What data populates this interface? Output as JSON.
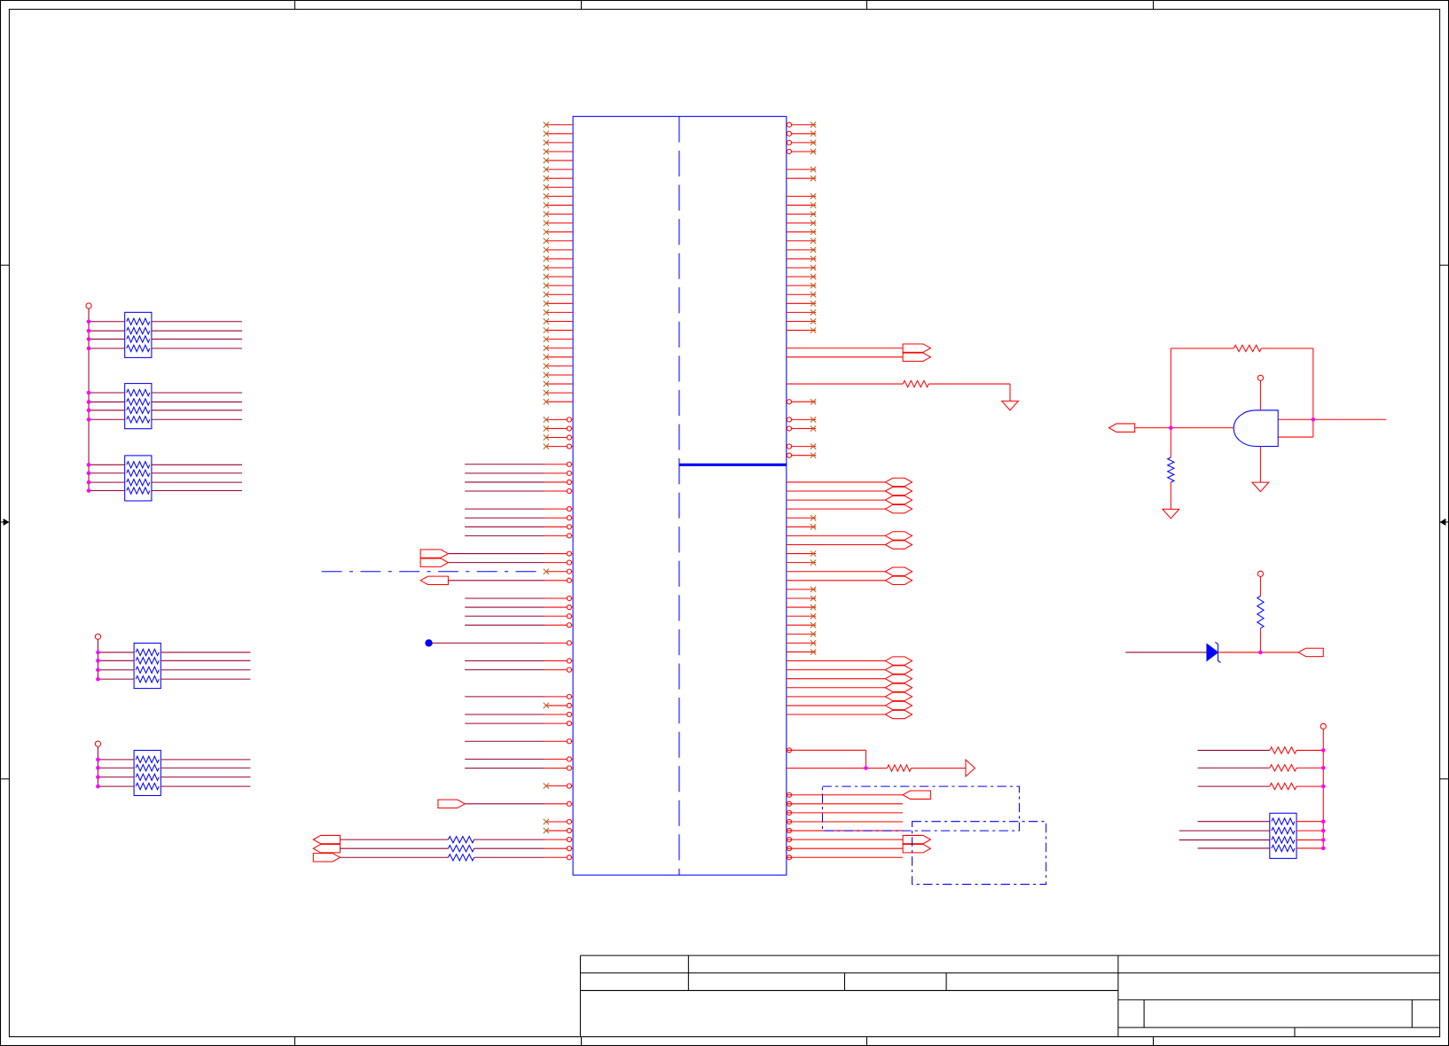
{
  "colors": {
    "background": "#ffffff",
    "frame": "#000000",
    "pin": "#ff0000",
    "wire": "#990033",
    "component": "#0000ff",
    "junction": "#ff00ff",
    "no_connect": "#b5651d"
  },
  "icons": {
    "resistor": "resistor-icon",
    "resistor_network": "resistor-network-icon",
    "and_gate": "and-gate-icon",
    "zener_diode": "zener-diode-icon",
    "ground": "ground-icon",
    "power": "power-pin-icon",
    "no_connect": "no-connect-icon",
    "port": "port-icon"
  }
}
